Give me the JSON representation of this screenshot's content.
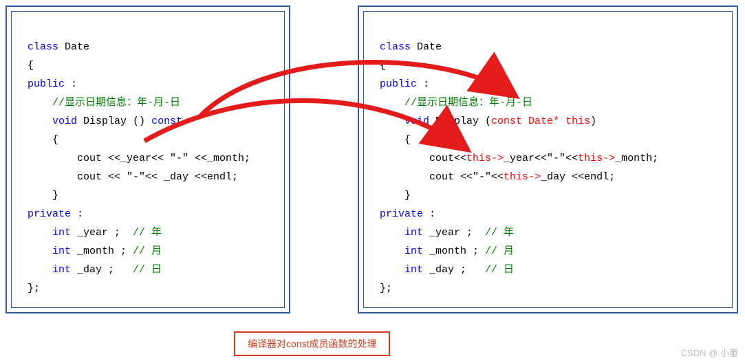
{
  "left": {
    "l1_class": "class",
    "l1_name": " Date",
    "l2": "{",
    "l3_public": "public",
    "l3_colon": " :",
    "l4_comment": "//显示日期信息：年-月-日",
    "l5_void": "void",
    "l5_disp": " Display () ",
    "l5_const": "const",
    "l6": "{",
    "l7": "cout <<_year<< \"-\" <<_month;",
    "l8": "cout << \"-\"<< _day <<endl;",
    "l9": "}",
    "l10_private": "private",
    "l10_colon": " :",
    "l11_int": "int",
    "l11_var": " _year ;  ",
    "l11_comment": "// 年",
    "l12_int": "int",
    "l12_var": " _month ; ",
    "l12_comment": "// 月",
    "l13_int": "int",
    "l13_var": " _day ;   ",
    "l13_comment": "// 日",
    "l14": "};"
  },
  "right": {
    "l1_class": "class",
    "l1_name": " Date",
    "l2": "{",
    "l3_public": "public",
    "l3_colon": " :",
    "l4_comment": "//显示日期信息：年-月-日",
    "l5_void": "void",
    "l5_disp": " Display (",
    "l5_param": "const Date* this",
    "l5_close": ")",
    "l6": "{",
    "l7a": "cout<<",
    "l7b": "this->",
    "l7c": "_year<<\"-\"<<",
    "l7d": "this->",
    "l7e": "_month;",
    "l8a": "cout <<\"-\"<<",
    "l8b": "this->",
    "l8c": "_day <<endl;",
    "l9": "}",
    "l10_private": "private",
    "l10_colon": " :",
    "l11_int": "int",
    "l11_var": " _year ;  ",
    "l11_comment": "// 年",
    "l12_int": "int",
    "l12_var": " _month ; ",
    "l12_comment": "// 月",
    "l13_int": "int",
    "l13_var": " _day ;   ",
    "l13_comment": "// 日",
    "l14": "};"
  },
  "caption": "编译器对const成员函数的处理",
  "watermark": "CSDN @.小董"
}
